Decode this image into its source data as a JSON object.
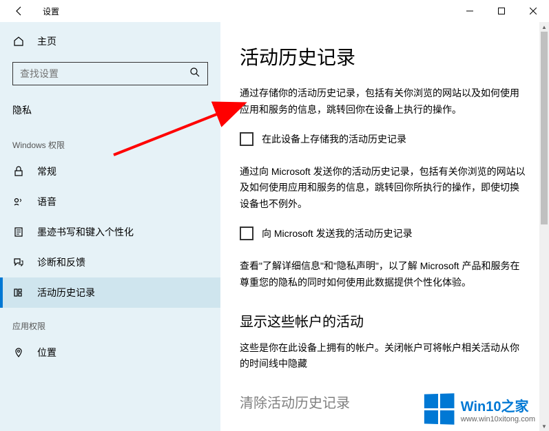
{
  "titlebar": {
    "title": "设置"
  },
  "sidebar": {
    "home": "主页",
    "search_placeholder": "查找设置",
    "section1_title": "隐私",
    "section_windows_perms": "Windows 权限",
    "items": [
      {
        "label": "常规"
      },
      {
        "label": "语音"
      },
      {
        "label": "墨迹书写和键入个性化"
      },
      {
        "label": "诊断和反馈"
      },
      {
        "label": "活动历史记录"
      }
    ],
    "section_app_perms": "应用权限",
    "items2": [
      {
        "label": "位置"
      }
    ]
  },
  "content": {
    "page_title": "活动历史记录",
    "desc1": "通过存储你的活动历史记录，包括有关你浏览的网站以及如何使用应用和服务的信息，跳转回你在设备上执行的操作。",
    "checkbox1_label": "在此设备上存储我的活动历史记录",
    "desc2": "通过向 Microsoft 发送你的活动历史记录，包括有关你浏览的网站以及如何使用应用和服务的信息，跳转回你所执行的操作，即使切换设备也不例外。",
    "checkbox2_label": "向 Microsoft 发送我的活动历史记录",
    "desc3": "查看\"了解详细信息\"和\"隐私声明\"，以了解 Microsoft 产品和服务在尊重您的隐私的同时如何使用此数据提供个性化体验。",
    "sub_title1": "显示这些帐户的活动",
    "desc4": "这些是你在此设备上拥有的帐户。关闭帐户可将帐户相关活动从你的时间线中隐藏",
    "sub_title2": "清除活动历史记录"
  },
  "watermark": {
    "brand": "Win10之家",
    "url": "www.win10xitong.com"
  }
}
